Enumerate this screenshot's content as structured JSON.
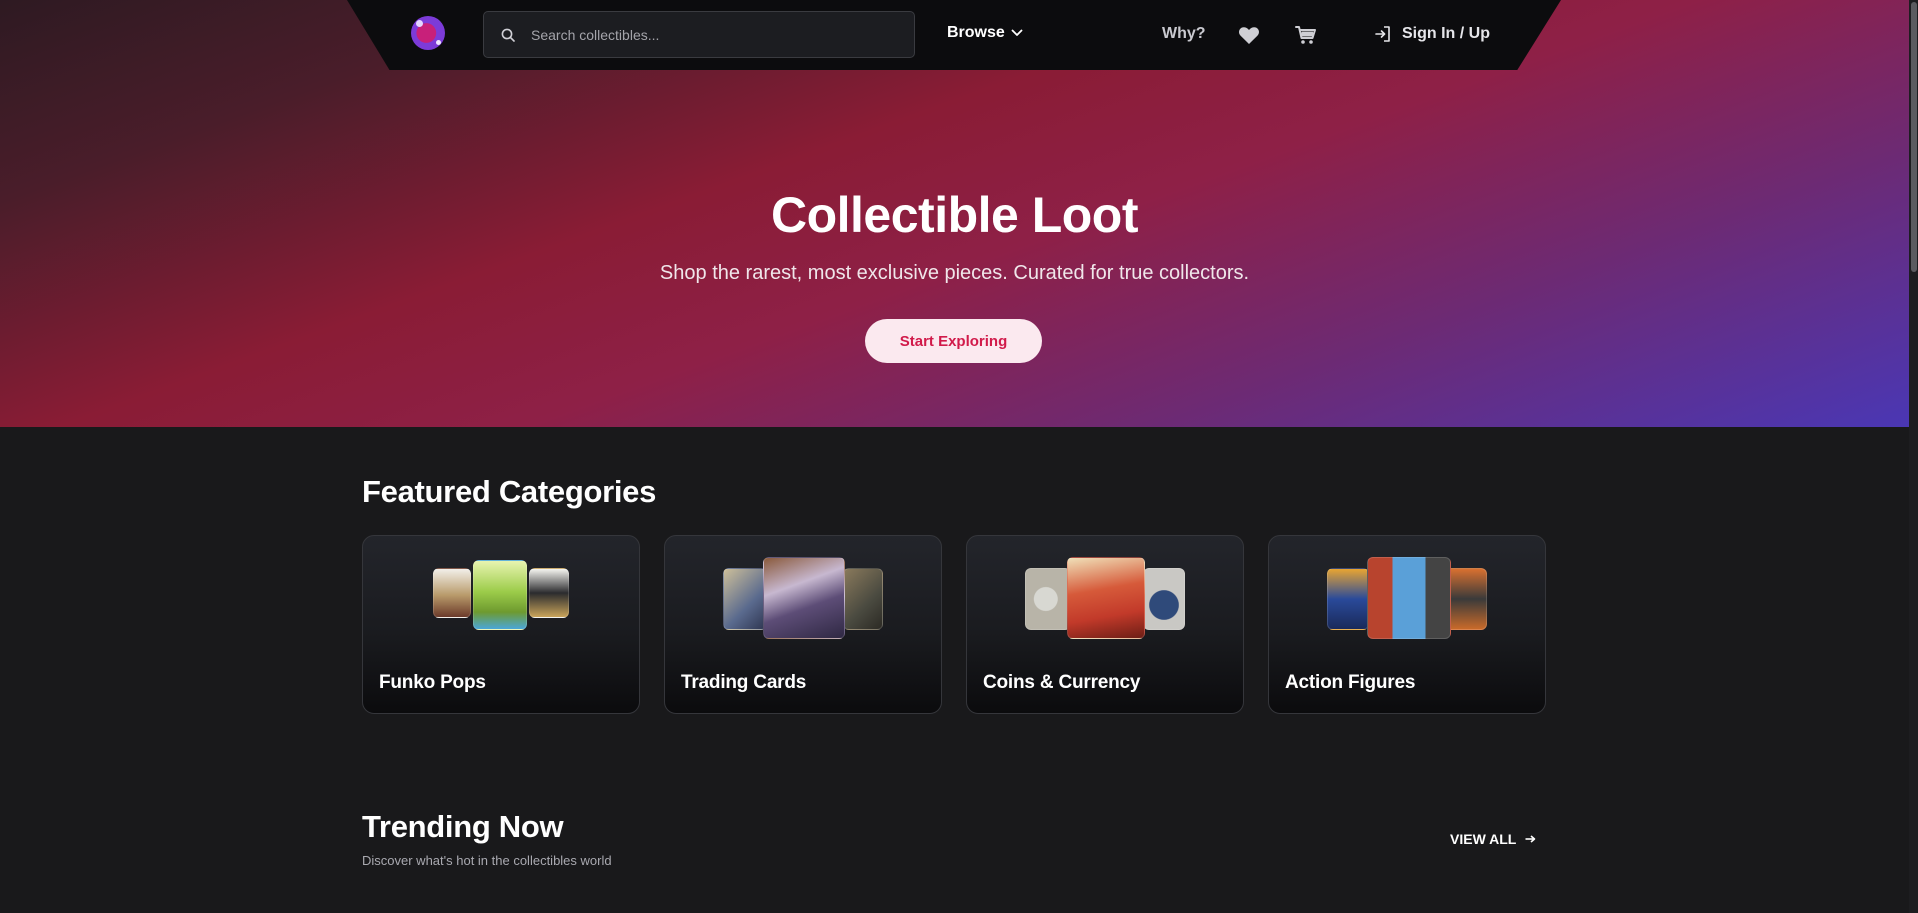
{
  "nav": {
    "search_placeholder": "Search collectibles...",
    "browse_label": "Browse",
    "why_label": "Why?",
    "signin_label": "Sign In / Up"
  },
  "hero": {
    "title": "Collectible Loot",
    "subtitle": "Shop the rarest, most exclusive pieces. Curated for true collectors.",
    "cta_label": "Start Exploring"
  },
  "featured": {
    "title": "Featured Categories",
    "categories": [
      {
        "name": "Funko Pops"
      },
      {
        "name": "Trading Cards"
      },
      {
        "name": "Coins & Currency"
      },
      {
        "name": "Action Figures"
      }
    ]
  },
  "trending": {
    "title": "Trending Now",
    "subtitle": "Discover what's hot in the collectibles world",
    "view_all_label": "VIEW ALL"
  },
  "colors": {
    "accent": "#d11a4a",
    "background": "#19191b",
    "navbar": "#0c0c0e"
  },
  "icons": [
    "logo-icon",
    "search-icon",
    "chevron-down-icon",
    "heart-icon",
    "cart-icon",
    "sign-in-icon",
    "arrow-right-icon"
  ]
}
